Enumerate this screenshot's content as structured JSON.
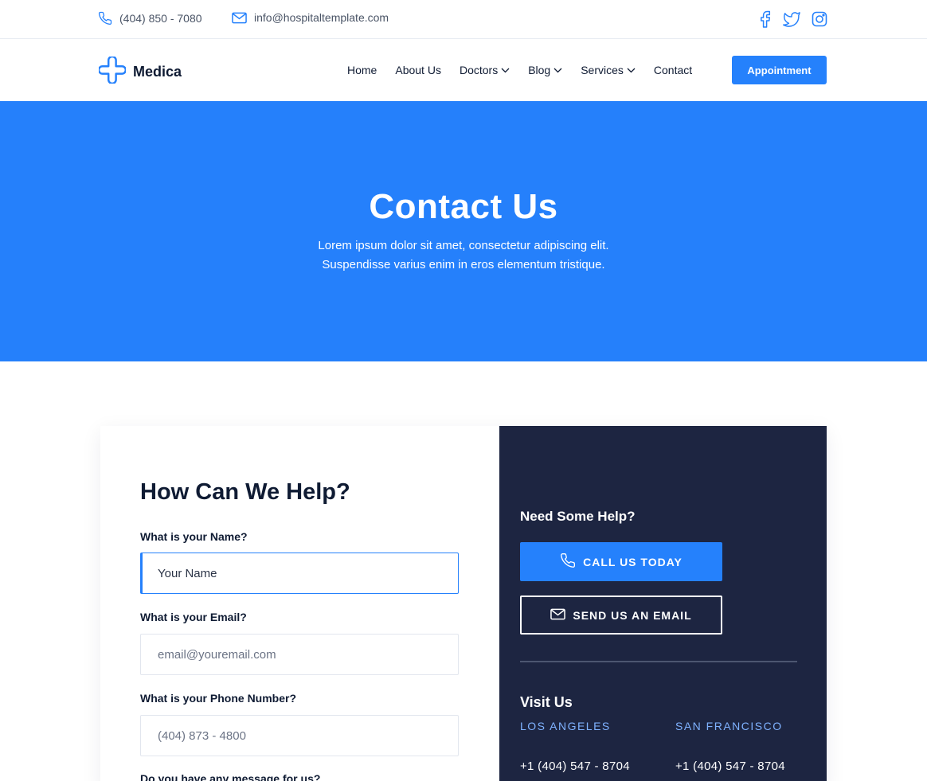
{
  "topbar": {
    "phone": "(404) 850 - 7080",
    "email": "info@hospitaltemplate.com",
    "socials": [
      "facebook-icon",
      "twitter-icon",
      "instagram-icon"
    ]
  },
  "brand": {
    "name": "Medica",
    "accent_color": "#2581fc",
    "dark_color": "#1d2541"
  },
  "nav": {
    "items": [
      {
        "label": "Home",
        "dropdown": false
      },
      {
        "label": "About Us",
        "dropdown": false
      },
      {
        "label": "Doctors",
        "dropdown": true
      },
      {
        "label": "Blog",
        "dropdown": true
      },
      {
        "label": "Services",
        "dropdown": true
      },
      {
        "label": "Contact",
        "dropdown": false
      }
    ],
    "cta": "Appointment"
  },
  "hero": {
    "title": "Contact Us",
    "subtitle_line1": "Lorem ipsum dolor sit amet, consectetur adipiscing elit.",
    "subtitle_line2": "Suspendisse varius enim in eros elementum tristique."
  },
  "form": {
    "title": "How Can We Help?",
    "name_label": "What is your Name?",
    "name_value": "Your Name",
    "email_label": "What is your Email?",
    "email_placeholder": "email@youremail.com",
    "phone_label": "What is your Phone Number?",
    "phone_placeholder": "(404) 873 - 4800",
    "message_label": "Do you have any message for us?"
  },
  "info": {
    "help_title": "Need Some Help?",
    "call_button": "CALL US TODAY",
    "email_button": "SEND US AN EMAIL",
    "visit_title": "Visit Us",
    "locations": [
      {
        "city": "LOS ANGELES",
        "phone": "+1 (404) 547 - 8704"
      },
      {
        "city": "SAN FRANCISCO",
        "phone": "+1 (404) 547 - 8704"
      }
    ]
  }
}
